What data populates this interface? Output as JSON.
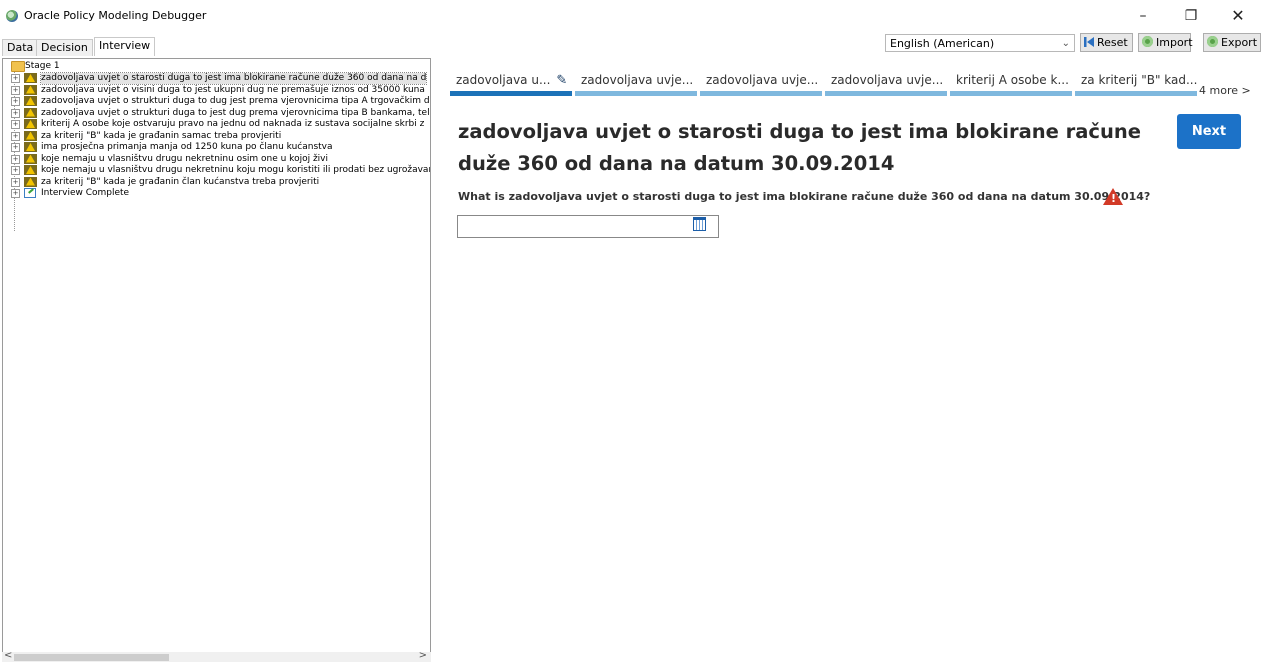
{
  "window": {
    "title": "Oracle Policy Modeling Debugger",
    "min_glyph": "–",
    "max_glyph": "❐",
    "close_glyph": "✕"
  },
  "left_tabs": [
    "Data",
    "Decision",
    "Interview"
  ],
  "toolbar": {
    "language": "English (American)",
    "language_chevron": "⌄",
    "reset_label": "Reset",
    "import_label": "Import",
    "export_label": "Export"
  },
  "tree": {
    "root": "Stage 1",
    "items": [
      "zadovoljava uvjet o starosti duga to jest ima blokirane račune duže 360 od dana na d",
      "zadovoljava uvjet o visini duga to jest ukupni dug ne premašuje iznos od 35000 kuna",
      "zadovoljava uvjet o strukturi duga to dug jest prema vjerovnicima tipa A trgovačkim d",
      "zadovoljava uvjet o strukturi duga to jest dug prema vjerovnicima tipa B bankama, tel",
      "kriterij A osobe koje ostvaruju pravo na jednu od naknada iz sustava socijalne skrbi z",
      "za kriterij \"B\" kada je građanin samac treba provjeriti",
      "ima prosječna primanja manja od 1250 kuna po članu kućanstva",
      "koje nemaju u vlasništvu drugu nekretninu osim one u kojoj živi",
      "koje nemaju u vlasništvu drugu nekretninu koju mogu koristiti ili prodati bez ugrožavan",
      "za kriterij \"B\" kada je građanin član kućanstva treba provjeriti"
    ],
    "complete": "Interview Complete"
  },
  "stage_tabs": [
    "zadovoljava u...",
    "zadovoljava uvje...",
    "zadovoljava uvje...",
    "zadovoljava uvje...",
    "kriterij A osobe k...",
    "za kriterij \"B\" kad..."
  ],
  "more_link": "4 more >",
  "question": {
    "title": "zadovoljava uvjet o starosti duga to jest ima blokirane račune duže 360 od dana na datum 30.09.2014",
    "prompt": "What is zadovoljava uvjet o starosti duga to jest ima blokirane račune duže 360 od dana na datum 30.09.2014?",
    "next_label": "Next",
    "date_value": ""
  },
  "colors": {
    "accent": "#1c72c8",
    "progress_active": "#1c72b8",
    "progress_inactive": "#7fb8de",
    "warning": "#d23a27"
  }
}
